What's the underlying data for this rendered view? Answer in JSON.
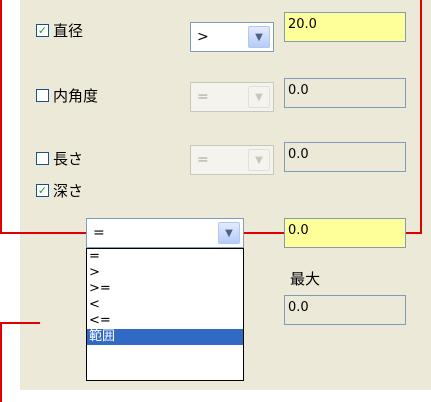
{
  "rows": [
    {
      "label": "直径",
      "checked": true,
      "operator": ">",
      "value": "20.0",
      "enabled": true
    },
    {
      "label": "内角度",
      "checked": false,
      "operator": "=",
      "value": "0.0",
      "enabled": false
    },
    {
      "label": "長さ",
      "checked": false,
      "operator": "=",
      "value": "0.0",
      "enabled": false
    },
    {
      "label": "深さ",
      "checked": true,
      "operator": "=",
      "value": "0.0",
      "enabled": true
    }
  ],
  "max_label": "最大",
  "max_value": "0.0",
  "dropdown_options": [
    "=",
    ">",
    ">=",
    "<",
    "<=",
    "範囲"
  ],
  "dropdown_selected": "範囲",
  "colors": {
    "highlight_red": "#e00000",
    "active_field": "#ffff99",
    "selection": "#316ac5"
  }
}
